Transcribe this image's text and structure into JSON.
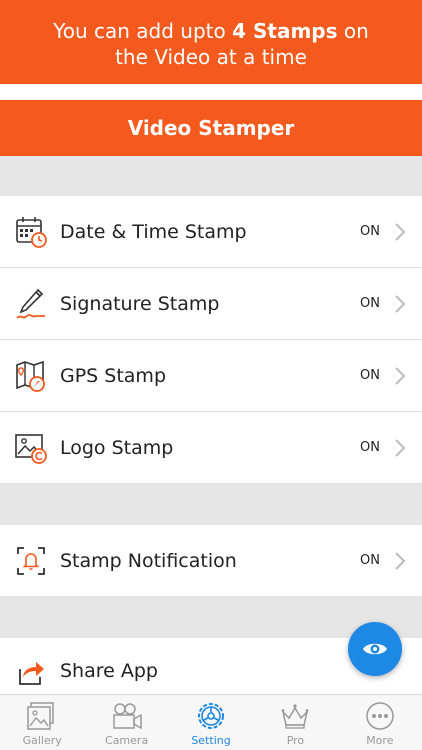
{
  "promo": {
    "line1_prefix": "You can add upto ",
    "line1_bold": "4 Stamps",
    "line1_suffix": " on",
    "line2": "the Video at a time"
  },
  "header": {
    "title": "Video Stamper"
  },
  "stamps": [
    {
      "label": "Date & Time Stamp",
      "state": "ON",
      "icon": "calendar-clock-icon"
    },
    {
      "label": "Signature Stamp",
      "state": "ON",
      "icon": "signature-pen-icon"
    },
    {
      "label": "GPS Stamp",
      "state": "ON",
      "icon": "map-pin-icon"
    },
    {
      "label": "Logo Stamp",
      "state": "ON",
      "icon": "image-copyright-icon"
    }
  ],
  "notification": {
    "label": "Stamp Notification",
    "state": "ON",
    "icon": "bell-frame-icon"
  },
  "share": {
    "label": "Share App",
    "icon": "share-arrow-icon"
  },
  "fab": {
    "icon": "eye-icon"
  },
  "tabs": [
    {
      "label": "Gallery",
      "icon": "gallery-icon",
      "active": false
    },
    {
      "label": "Camera",
      "icon": "video-camera-icon",
      "active": false
    },
    {
      "label": "Setting",
      "icon": "settings-wheel-icon",
      "active": true
    },
    {
      "label": "Pro",
      "icon": "crown-icon",
      "active": false
    },
    {
      "label": "More",
      "icon": "more-dots-icon",
      "active": false
    }
  ],
  "colors": {
    "accent": "#f4591e",
    "blue": "#1e88e5",
    "gray": "#e6e6e6"
  }
}
